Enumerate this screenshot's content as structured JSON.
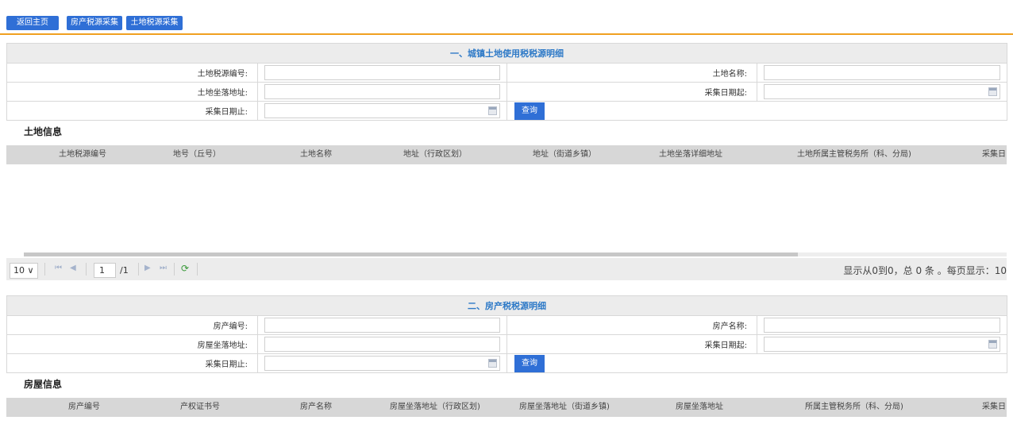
{
  "toolbar": {
    "home_label": "返回主页",
    "house_collect_label": "房产税源采集",
    "land_collect_label": "土地税源采集"
  },
  "land": {
    "title": "一、城镇土地使用税税源明细",
    "source_no_label": "土地税源编号:",
    "name_label": "土地名称:",
    "address_label": "土地坐落地址:",
    "date_from_label": "采集日期起:",
    "date_to_label": "采集日期止:",
    "query_label": "查询",
    "section_title": "土地信息",
    "columns": [
      "土地税源编号",
      "地号（丘号）",
      "土地名称",
      "地址（行政区划）",
      "地址（街道乡镇）",
      "土地坐落详细地址",
      "土地所属主管税务所（科、分局)",
      "采集日"
    ]
  },
  "pager": {
    "page_size": "10",
    "current_page": "1",
    "total_pages": "/1",
    "info": "显示从0到0，总 0 条 。每页显示：10"
  },
  "house": {
    "title": "二、房产税税源明细",
    "no_label": "房产编号:",
    "name_label": "房产名称:",
    "address_label": "房屋坐落地址:",
    "date_from_label": "采集日期起:",
    "date_to_label": "采集日期止:",
    "query_label": "查询",
    "section_title": "房屋信息",
    "columns": [
      "房产编号",
      "产权证书号",
      "房产名称",
      "房屋坐落地址（行政区划)",
      "房屋坐落地址（街道乡镇)",
      "房屋坐落地址",
      "所属主管税务所（科、分局)",
      "采集日"
    ]
  },
  "colors": {
    "primary_button": "#2f6fd6",
    "header_text": "#2d79c7",
    "accent_line": "#f0a020",
    "grid_header_bg": "#d7d7d7"
  }
}
